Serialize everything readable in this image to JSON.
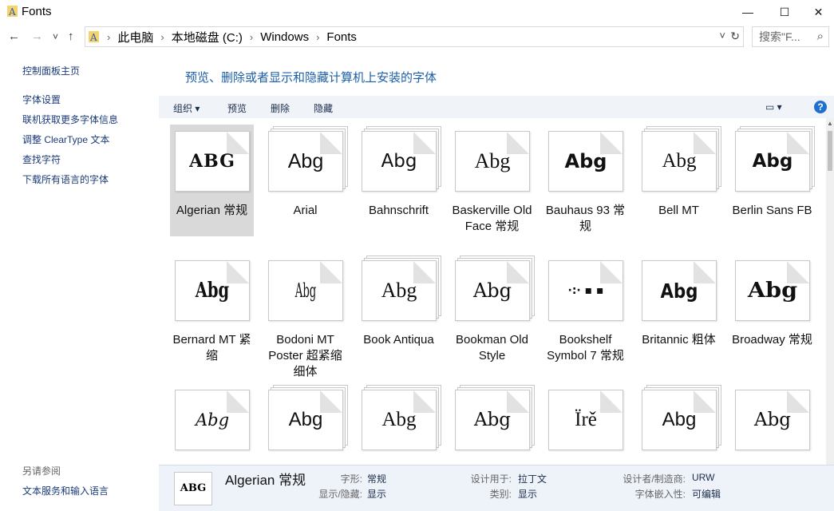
{
  "window": {
    "title": "Fonts"
  },
  "window_controls": {
    "minimize": "—",
    "maximize": "☐",
    "close": "✕"
  },
  "nav": {
    "back": "←",
    "forward": "→",
    "recent": "˅",
    "up": "↑"
  },
  "address": {
    "crumbs": [
      "此电脑",
      "本地磁盘 (C:)",
      "Windows",
      "Fonts"
    ],
    "dropdown": "˅",
    "refresh": "↻"
  },
  "search": {
    "placeholder": "搜索\"F...",
    "icon": "⌕"
  },
  "left_pane": {
    "home": "控制面板主页",
    "links": [
      "字体设置",
      "联机获取更多字体信息",
      "调整 ClearType 文本",
      "查找字符",
      "下载所有语言的字体"
    ],
    "see_also_label": "另请参阅",
    "see_also_link": "文本服务和输入语言"
  },
  "heading": "预览、删除或者显示和隐藏计算机上安装的字体",
  "toolbar": {
    "organize": "组织 ▾",
    "preview": "预览",
    "delete": "删除",
    "hide": "隐藏",
    "view_icon": "▭ ▾",
    "help": "?"
  },
  "fonts": [
    {
      "name": "Algerian 常规",
      "sample": "ABG",
      "stack": 1
    },
    {
      "name": "Arial",
      "sample": "Abg",
      "stack": 3
    },
    {
      "name": "Bahnschrift",
      "sample": "Abg",
      "stack": 3
    },
    {
      "name": "Baskerville Old Face 常规",
      "sample": "Abg",
      "stack": 1
    },
    {
      "name": "Bauhaus 93 常规",
      "sample": "Abg",
      "stack": 1
    },
    {
      "name": "Bell MT",
      "sample": "Abg",
      "stack": 3
    },
    {
      "name": "Berlin Sans FB",
      "sample": "Abg",
      "stack": 3
    },
    {
      "name": "Bernard MT 紧缩",
      "sample": "Abg",
      "stack": 1
    },
    {
      "name": "Bodoni MT Poster 超紧缩 细体",
      "sample": "Abg",
      "stack": 1
    },
    {
      "name": "Book Antiqua",
      "sample": "Abg",
      "stack": 3
    },
    {
      "name": "Bookman Old Style",
      "sample": "Abg",
      "stack": 3
    },
    {
      "name": "Bookshelf Symbol 7 常规",
      "sample": "·:·  ▪  ▪",
      "stack": 1
    },
    {
      "name": "Britannic 粗体",
      "sample": "Abg",
      "stack": 1
    },
    {
      "name": "Broadway 常规",
      "sample": "Abg",
      "stack": 1
    },
    {
      "name": "",
      "sample": "Abg",
      "stack": 1
    },
    {
      "name": "",
      "sample": "Abg",
      "stack": 3
    },
    {
      "name": "",
      "sample": "Abg",
      "stack": 3
    },
    {
      "name": "",
      "sample": "Abg",
      "stack": 3
    },
    {
      "name": "",
      "sample": "Ïrě",
      "stack": 1
    },
    {
      "name": "",
      "sample": "Abg",
      "stack": 3
    },
    {
      "name": "",
      "sample": "Abg",
      "stack": 1
    }
  ],
  "details": {
    "icon_sample": "ABG",
    "name": "Algerian 常规",
    "fields": [
      {
        "k": "字形:",
        "v": "常规"
      },
      {
        "k": "显示/隐藏:",
        "v": "显示"
      },
      {
        "k": "设计用于:",
        "v": "拉丁文"
      },
      {
        "k": "类别:",
        "v": "显示"
      },
      {
        "k": "设计者/制造商:",
        "v": "URW"
      },
      {
        "k": "字体嵌入性:",
        "v": "可编辑"
      }
    ]
  }
}
